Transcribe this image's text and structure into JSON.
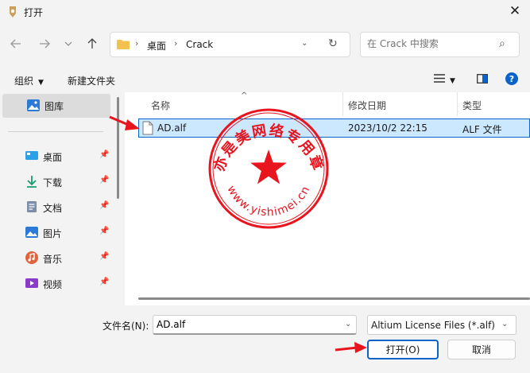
{
  "window": {
    "title": "打开"
  },
  "nav": {
    "breadcrumbs": [
      "桌面",
      "Crack"
    ],
    "search_placeholder": "在 Crack 中搜索"
  },
  "toolbar": {
    "organize": "组织",
    "new_folder": "新建文件夹"
  },
  "sidebar": {
    "gallery": "图库",
    "items": [
      {
        "label": "桌面",
        "icon": "desktop-icon"
      },
      {
        "label": "下载",
        "icon": "download-icon"
      },
      {
        "label": "文档",
        "icon": "document-icon"
      },
      {
        "label": "图片",
        "icon": "picture-icon"
      },
      {
        "label": "音乐",
        "icon": "music-icon"
      },
      {
        "label": "视频",
        "icon": "video-icon"
      }
    ]
  },
  "filelist": {
    "columns": [
      "名称",
      "修改日期",
      "类型"
    ],
    "rows": [
      {
        "name": "AD.alf",
        "modified": "2023/10/2 22:15",
        "type": "ALF 文件"
      }
    ]
  },
  "watermark": {
    "text": "亦是美网络专用章",
    "url": "www.yishimei.cn"
  },
  "bottom": {
    "filename_label": "文件名(N):",
    "filename_value": "AD.alf",
    "filetype_value": "Altium License Files (*.alf)",
    "open_label": "打开(O)",
    "cancel_label": "取消"
  },
  "colors": {
    "accent": "#0a63c7",
    "selection": "#cce8ff",
    "stamp_red": "#e8141e"
  }
}
